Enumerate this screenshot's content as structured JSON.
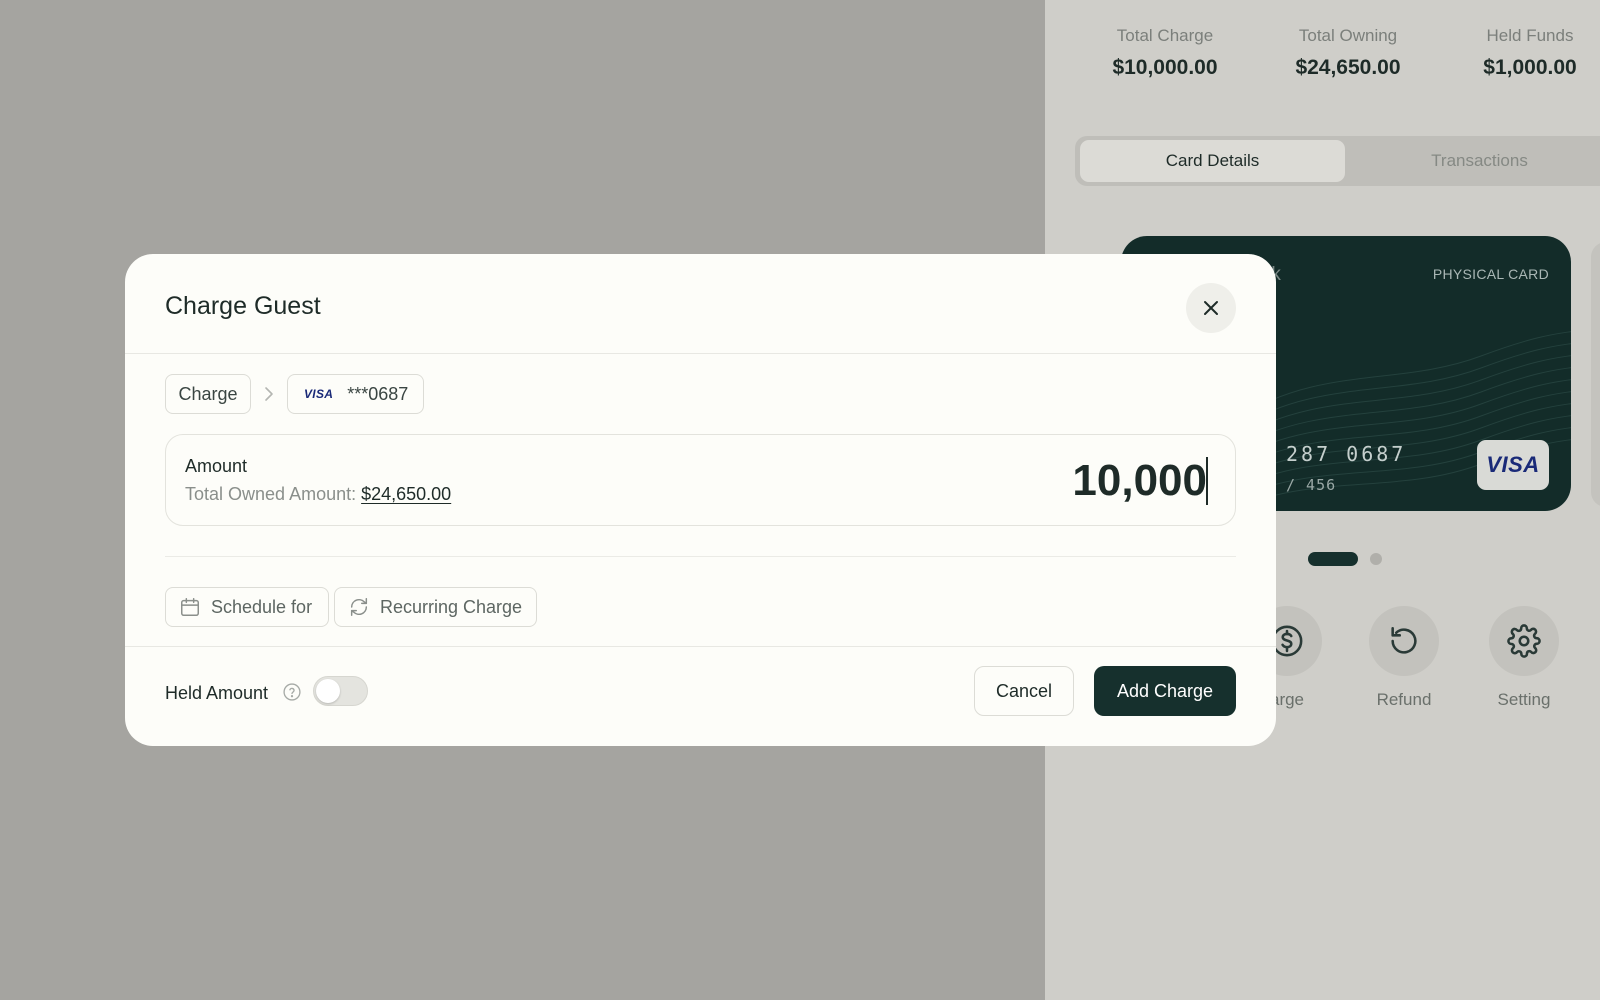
{
  "side_panel": {
    "stats": [
      {
        "label": "Total Charge",
        "value": "$10,000.00"
      },
      {
        "label": "Total Owning",
        "value": "$24,650.00"
      },
      {
        "label": "Held Funds",
        "value": "$1,000.00"
      }
    ],
    "tabs": [
      {
        "label": "Card Details",
        "active": true
      },
      {
        "label": "Transactions",
        "active": false
      }
    ],
    "card": {
      "brand_partial": "tack",
      "type": "PHYSICAL CARD",
      "number_partial": "287 0687",
      "cvv_partial": "/  456",
      "network": "VISA"
    },
    "actions": [
      {
        "label": "arge",
        "icon": "dollar-circle-icon"
      },
      {
        "label": "Refund",
        "icon": "refund-icon"
      },
      {
        "label": "Setting",
        "icon": "gear-icon"
      }
    ]
  },
  "modal": {
    "title": "Charge Guest",
    "breadcrumb": {
      "step1": "Charge",
      "card_network": "VISA",
      "card_masked": "***0687"
    },
    "amount": {
      "label": "Amount",
      "owned_label": "Total Owned Amount:",
      "owned_value": "$24,650.00",
      "value": "10,000"
    },
    "options": {
      "schedule": "Schedule for",
      "recurring": "Recurring Charge"
    },
    "footer": {
      "held_label": "Held Amount",
      "held_enabled": false,
      "cancel_label": "Cancel",
      "add_label": "Add Charge"
    }
  },
  "colors": {
    "primary": "#16302d",
    "overlay": "#a5a4a0",
    "modal_bg": "#fdfdf9",
    "visa_blue": "#1a2a78"
  }
}
